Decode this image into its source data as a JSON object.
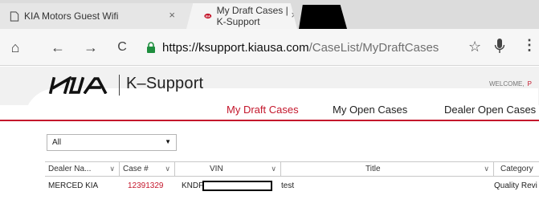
{
  "browser": {
    "tabs": [
      {
        "title": "KIA Motors Guest Wifi",
        "icon": "page-icon",
        "close": "×"
      },
      {
        "title": "My Draft Cases | K-Support",
        "icon": "kia-favicon-icon",
        "close": "×"
      }
    ],
    "url_host": "https://ksupport.kiausa.com",
    "url_path": "/CaseList/MyDraftCases",
    "icons": {
      "home": "⌂",
      "back": "←",
      "forward": "→",
      "reload": "C",
      "star": "☆",
      "menu": "⋮"
    }
  },
  "site": {
    "brand": "K–Support",
    "welcome_label": "WELCOME,",
    "welcome_user": "P",
    "accent": "#c4172c"
  },
  "nav": {
    "draft": "My Draft Cases",
    "open": "My Open Cases",
    "dealer": "Dealer Open Cases"
  },
  "filter": {
    "value": "All",
    "caret": "▼"
  },
  "grid": {
    "columns": [
      {
        "label": "Dealer Na...",
        "dd": "∨"
      },
      {
        "label": "Case #",
        "dd": "∨"
      },
      {
        "label": "VIN",
        "dd": "∨"
      },
      {
        "label": "Title",
        "dd": "∨"
      },
      {
        "label": "Category",
        "dd": ""
      }
    ],
    "rows": [
      {
        "dealer": "MERCED KIA",
        "case_no": "12391329",
        "vin_prefix": "KNDF",
        "title": "test",
        "category": "Quality Revi"
      }
    ]
  }
}
